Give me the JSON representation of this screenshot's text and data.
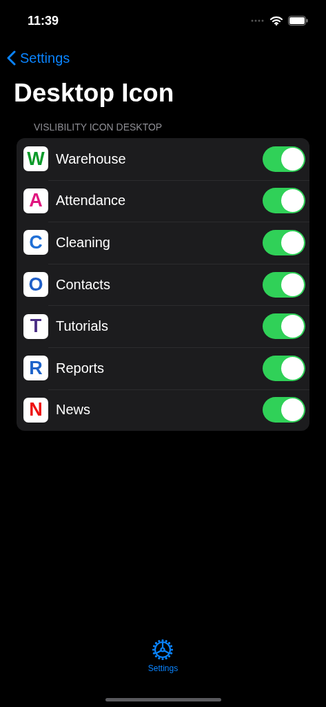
{
  "status_bar": {
    "time": "11:39"
  },
  "nav": {
    "back_label": "Settings"
  },
  "title": "Desktop Icon",
  "section": {
    "header": "VISLIBILITY ICON DESKTOP",
    "items": [
      {
        "label": "Warehouse",
        "logo": "W",
        "color": "#0a9a2a",
        "on": true
      },
      {
        "label": "Attendance",
        "logo": "A",
        "color": "#e0157f",
        "on": true
      },
      {
        "label": "Cleaning",
        "logo": "C",
        "color": "#1f6fd6",
        "on": true
      },
      {
        "label": "Contacts",
        "logo": "O",
        "color": "#1f5fc8",
        "on": true
      },
      {
        "label": "Tutorials",
        "logo": "T",
        "color": "#4b2f86",
        "on": true
      },
      {
        "label": "Reports",
        "logo": "R",
        "color": "#1d63c9",
        "on": true
      },
      {
        "label": "News",
        "logo": "N",
        "color": "#ee1111",
        "on": true
      }
    ]
  },
  "tab_bar": {
    "tabs": [
      {
        "label": "Settings",
        "selected": true
      }
    ]
  }
}
